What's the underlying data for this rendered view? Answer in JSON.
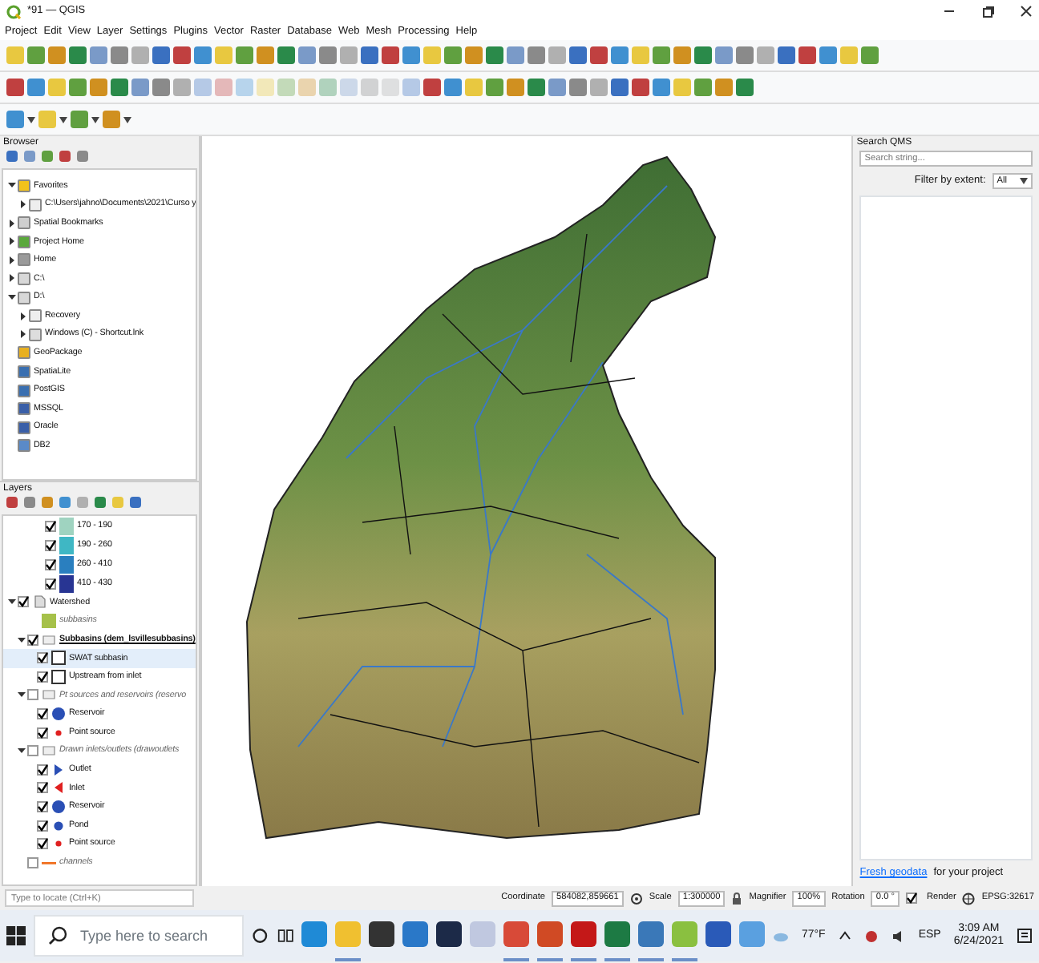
{
  "window": {
    "title": "*91 — QGIS"
  },
  "menu": [
    "Project",
    "Edit",
    "View",
    "Layer",
    "Settings",
    "Plugins",
    "Vector",
    "Raster",
    "Database",
    "Web",
    "Mesh",
    "Processing",
    "Help"
  ],
  "browser": {
    "title": "Browser",
    "items": [
      {
        "label": "Favorites",
        "kind": "star",
        "expanded": true,
        "children": [
          {
            "label": "C:\\Users\\jahno\\Documents\\2021\\Curso y",
            "kind": "folder",
            "expanded": false
          }
        ]
      },
      {
        "label": "Spatial Bookmarks",
        "kind": "bookmark",
        "expanded": false
      },
      {
        "label": "Project Home",
        "kind": "project",
        "expanded": false
      },
      {
        "label": "Home",
        "kind": "home",
        "expanded": false
      },
      {
        "label": "C:\\",
        "kind": "drive",
        "expanded": false
      },
      {
        "label": "D:\\",
        "kind": "drive",
        "expanded": true,
        "children": [
          {
            "label": "Recovery",
            "kind": "folder",
            "expanded": false
          },
          {
            "label": "Windows (C) - Shortcut.lnk",
            "kind": "shortcut",
            "expanded": false
          }
        ]
      },
      {
        "label": "GeoPackage",
        "kind": "geopackage"
      },
      {
        "label": "SpatiaLite",
        "kind": "spatialite"
      },
      {
        "label": "PostGIS",
        "kind": "postgis"
      },
      {
        "label": "MSSQL",
        "kind": "mssql"
      },
      {
        "label": "Oracle",
        "kind": "oracle"
      },
      {
        "label": "DB2",
        "kind": "db2"
      }
    ]
  },
  "layers": {
    "title": "Layers",
    "partial_legend": [
      {
        "label": "170 - 190",
        "checked": true,
        "color": "#9fd3c0"
      },
      {
        "label": "190 - 260",
        "checked": true,
        "color": "#3fb7c4"
      },
      {
        "label": "260 - 410",
        "checked": true,
        "color": "#2a7fbf"
      },
      {
        "label": "410 - 430",
        "checked": true,
        "color": "#283593"
      }
    ],
    "items": [
      {
        "label": "Watershed",
        "kind": "group",
        "checked": true,
        "expanded": true,
        "active": false,
        "out_of_scale": false,
        "selected": false,
        "children": [
          {
            "label": "subbasins",
            "kind": "patch",
            "color": "#a6c14a",
            "active": false,
            "out_of_scale": true,
            "selected": false
          },
          {
            "label": "Subbasins (dem_lsvillesubbasins)",
            "kind": "layer",
            "checked": true,
            "expanded": true,
            "active": true,
            "out_of_scale": false,
            "selected": false,
            "children": [
              {
                "label": "SWAT subbasin",
                "kind": "square",
                "checked": true,
                "active": false,
                "out_of_scale": false,
                "selected": true
              },
              {
                "label": "Upstream from inlet",
                "kind": "square",
                "checked": true,
                "active": false,
                "out_of_scale": false,
                "selected": false
              }
            ]
          },
          {
            "label": "Pt sources and reservoirs (reservo",
            "kind": "layer",
            "checked": false,
            "expanded": true,
            "active": false,
            "out_of_scale": true,
            "selected": false,
            "children": [
              {
                "label": "Reservoir",
                "kind": "circle",
                "checked": true,
                "color": "#2a4fb5",
                "active": false,
                "out_of_scale": false,
                "selected": false
              },
              {
                "label": "Point source",
                "kind": "dot",
                "checked": true,
                "color": "#e02020",
                "active": false,
                "out_of_scale": false,
                "selected": false
              }
            ]
          },
          {
            "label": "Drawn inlets/outlets (drawoutlets",
            "kind": "layer",
            "checked": false,
            "expanded": true,
            "active": false,
            "out_of_scale": true,
            "selected": false,
            "children": [
              {
                "label": "Outlet",
                "kind": "triangle-right",
                "checked": true,
                "color": "#2a4fb5",
                "active": false,
                "out_of_scale": false,
                "selected": false
              },
              {
                "label": "Inlet",
                "kind": "triangle-left",
                "checked": true,
                "color": "#e02020",
                "active": false,
                "out_of_scale": false,
                "selected": false
              },
              {
                "label": "Reservoir",
                "kind": "circle",
                "checked": true,
                "color": "#2a4fb5",
                "active": false,
                "out_of_scale": false,
                "selected": false
              },
              {
                "label": "Pond",
                "kind": "dot-medium",
                "checked": true,
                "color": "#2a4fb5",
                "active": false,
                "out_of_scale": false,
                "selected": false
              },
              {
                "label": "Point source",
                "kind": "dot",
                "checked": true,
                "color": "#e02020",
                "active": false,
                "out_of_scale": false,
                "selected": false
              }
            ]
          },
          {
            "label": "channels",
            "kind": "line",
            "checked": false,
            "color": "#f07020",
            "active": false,
            "out_of_scale": true,
            "selected": false
          }
        ]
      }
    ]
  },
  "search_qms": {
    "title": "Search QMS",
    "placeholder": "Search string...",
    "filter_label": "Filter by extent:",
    "filter_value": "All",
    "footer_link": "Fresh geodata",
    "footer_text": "for your project"
  },
  "status_bar": {
    "locate_placeholder": "Type to locate (Ctrl+K)",
    "coordinate_label": "Coordinate",
    "coordinate": "584082,859661",
    "scale_label": "Scale",
    "scale": "1:300000",
    "magnifier_label": "Magnifier",
    "magnifier": "100%",
    "rotation_label": "Rotation",
    "rotation": "0.0 °",
    "render_label": "Render",
    "render_checked": true,
    "crs": "EPSG:32617"
  },
  "taskbar": {
    "search_placeholder": "Type here to search",
    "apps": [
      {
        "kind": "edge",
        "running": false
      },
      {
        "kind": "explorer",
        "running": true
      },
      {
        "kind": "store",
        "running": false
      },
      {
        "kind": "mail",
        "running": false
      },
      {
        "kind": "terminal",
        "running": false
      },
      {
        "kind": "paint",
        "running": false
      },
      {
        "kind": "chrome",
        "running": true
      },
      {
        "kind": "powerpoint",
        "running": true
      },
      {
        "kind": "pdf",
        "running": true
      },
      {
        "kind": "excel",
        "running": true
      },
      {
        "kind": "qgis-blue",
        "running": true
      },
      {
        "kind": "qgis",
        "running": true
      },
      {
        "kind": "photos",
        "running": false
      },
      {
        "kind": "globe",
        "running": false
      }
    ],
    "weather": "77°F",
    "language": "ESP",
    "time": "3:09 AM",
    "date": "6/24/2021"
  }
}
